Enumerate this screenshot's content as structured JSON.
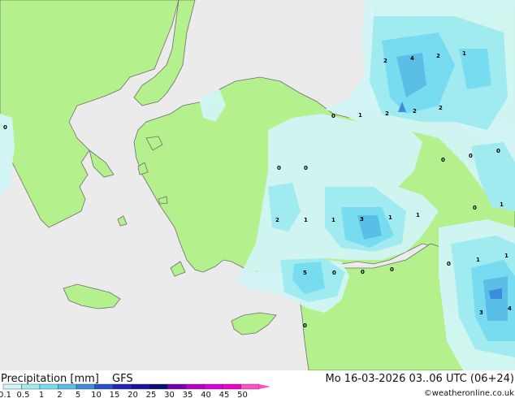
{
  "map": {
    "colors": {
      "sea": "#ebebeb",
      "land": "#b4f08c",
      "coast": "#6e6e6e",
      "precip_0_1": "#d2f5f5",
      "precip_0_5": "#a0ebf0",
      "precip_1": "#78dcf0",
      "precip_2": "#5abee6",
      "precip_5": "#3c8cdc"
    },
    "values": [
      {
        "text": "2"
      },
      {
        "text": "4"
      },
      {
        "text": "2"
      },
      {
        "text": "1"
      },
      {
        "text": "0"
      },
      {
        "text": "1"
      },
      {
        "text": "2"
      },
      {
        "text": "2"
      },
      {
        "text": "2"
      },
      {
        "text": "0"
      },
      {
        "text": "0"
      },
      {
        "text": "0"
      },
      {
        "text": "0"
      },
      {
        "text": "0"
      },
      {
        "text": "2"
      },
      {
        "text": "1"
      },
      {
        "text": "1"
      },
      {
        "text": "3"
      },
      {
        "text": "1"
      },
      {
        "text": "1"
      },
      {
        "text": "0"
      },
      {
        "text": "1"
      },
      {
        "text": "5"
      },
      {
        "text": "0"
      },
      {
        "text": "0"
      },
      {
        "text": "0"
      },
      {
        "text": "0"
      },
      {
        "text": "1"
      },
      {
        "text": "1"
      },
      {
        "text": "4"
      },
      {
        "text": "3"
      },
      {
        "text": "0"
      },
      {
        "text": "0"
      }
    ]
  },
  "footer": {
    "title": "Precipitation [mm]",
    "model": "GFS",
    "datetime": "Mo 16-03-2026 03..06 UTC (06+24)",
    "credit": "©weatheronline.co.uk"
  },
  "legend": {
    "ticks": [
      "0.1",
      "0.5",
      "1",
      "2",
      "5",
      "10",
      "15",
      "20",
      "25",
      "30",
      "35",
      "40",
      "45",
      "50"
    ],
    "colors": [
      "#d2f5f5",
      "#a0ebf0",
      "#78dcf0",
      "#5abee6",
      "#3c8cdc",
      "#2850c8",
      "#1e28b4",
      "#14149a",
      "#0a0a78",
      "#7800aa",
      "#b400c8",
      "#dc00dc",
      "#f000c8",
      "#ff50c8"
    ]
  }
}
